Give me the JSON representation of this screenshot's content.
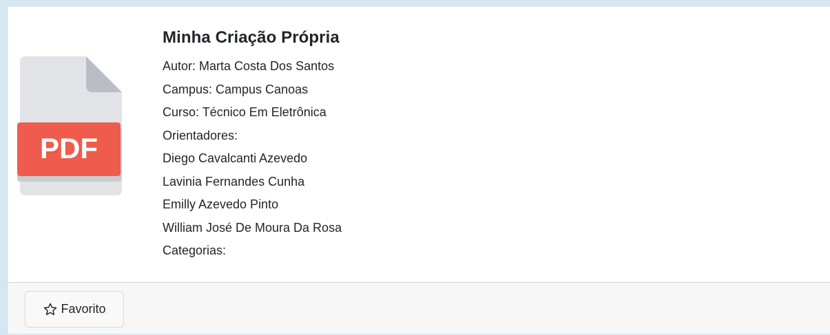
{
  "item": {
    "title": "Minha Criação Própria",
    "author": "Autor: Marta Costa Dos Santos",
    "campus": "Campus: Campus Canoas",
    "course": "Curso: Técnico Em Eletrônica",
    "advisors_label": "Orientadores:",
    "advisors": [
      "Diego Cavalcanti Azevedo",
      "Lavinia Fernandes Cunha",
      "Emilly Azevedo Pinto",
      "William José De Moura Da Rosa"
    ],
    "categories_label": "Categorias:",
    "file_icon": "pdf-file-icon",
    "file_badge": "PDF"
  },
  "footer": {
    "favorite_label": "Favorito",
    "favorite_icon": "star-outline-icon"
  },
  "colors": {
    "pdf_red": "#ef5b4c",
    "page_gray": "#e1e3e6",
    "fold_gray": "#b9bec4",
    "frame_blue": "#d7e7f1"
  }
}
